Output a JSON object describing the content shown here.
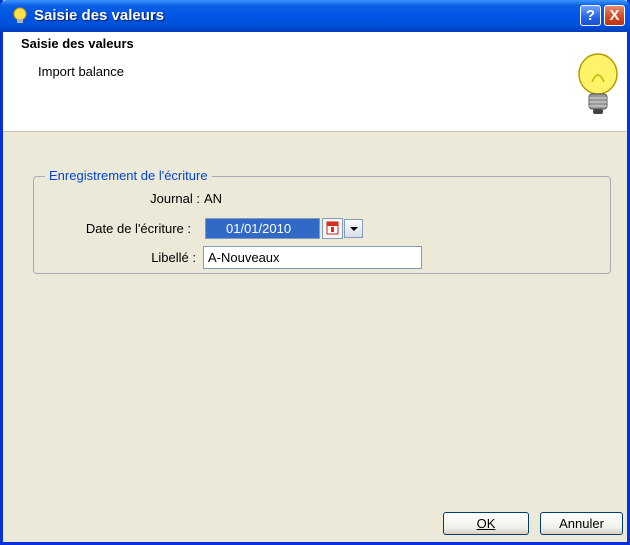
{
  "window": {
    "title": "Saisie des valeurs",
    "help_label": "?",
    "close_label": "X"
  },
  "header": {
    "title": "Saisie des valeurs",
    "subtitle": "Import balance",
    "icon": "lightbulb-icon"
  },
  "group": {
    "legend": "Enregistrement de l'écriture",
    "journal_label": "Journal :",
    "journal_value": "AN",
    "date_label": "Date de l'écriture :",
    "date_value": "01/01/2010",
    "libelle_label": "Libellé :",
    "libelle_value": "A-Nouveaux"
  },
  "buttons": {
    "ok_label": "OK",
    "cancel_label": "Annuler"
  },
  "colors": {
    "title_bar": "#0054e3",
    "legend": "#0046d5",
    "selection": "#3169c6",
    "dialog_bg": "#ece9d8"
  }
}
